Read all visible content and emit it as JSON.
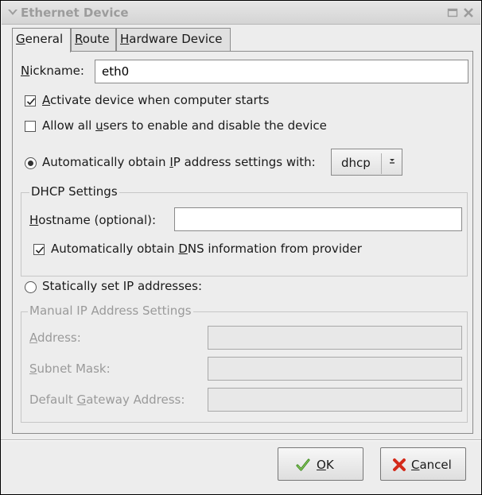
{
  "window": {
    "title": "Ethernet Device"
  },
  "tabs": [
    {
      "label": "General",
      "mnemonic": "G",
      "rest": "eneral",
      "active": true
    },
    {
      "label": "Route",
      "mnemonic": "R",
      "rest": "oute",
      "active": false
    },
    {
      "label": "Hardware Device",
      "mnemonic": "H",
      "rest": "ardware Device",
      "active": false
    }
  ],
  "general": {
    "nickname": {
      "label_mnemonic": "N",
      "label_rest": "ickname:",
      "value": "eth0"
    },
    "activate_on_boot": {
      "checked": true,
      "mnemonic": "A",
      "label_rest": "ctivate device when computer starts"
    },
    "allow_users": {
      "checked": false,
      "pre": "Allow all ",
      "mnemonic": "u",
      "post": "sers to enable and disable the device"
    },
    "auto_ip": {
      "selected": true,
      "pre": "Automatically obtain ",
      "mnemonic": "I",
      "post": "P address settings with:",
      "method": "dhcp"
    },
    "dhcp_settings": {
      "title": "DHCP Settings",
      "hostname": {
        "mnemonic": "H",
        "label_rest": "ostname (optional):",
        "value": ""
      },
      "auto_dns": {
        "checked": true,
        "pre": "Automatically obtain ",
        "mnemonic": "D",
        "post": "NS information from provider"
      }
    },
    "static_ip": {
      "selected": false,
      "label": "Statically set IP addresses:"
    },
    "manual_settings": {
      "title": "Manual IP Address Settings",
      "address": {
        "mnemonic": "A",
        "label_rest": "ddress:",
        "value": ""
      },
      "subnet": {
        "mnemonic": "S",
        "label_rest": "ubnet Mask:",
        "value": ""
      },
      "gateway": {
        "pre": "Default ",
        "mnemonic": "G",
        "post": "ateway Address:",
        "value": ""
      }
    }
  },
  "buttons": {
    "ok": {
      "mnemonic": "O",
      "rest": "K"
    },
    "cancel": {
      "mnemonic": "C",
      "rest": "ancel"
    }
  },
  "colors": {
    "ok_check": "#3a8a1e",
    "cancel_x": "#d42a1a",
    "radio_dot": "#333333",
    "disabled_text": "#9a9a9a"
  }
}
